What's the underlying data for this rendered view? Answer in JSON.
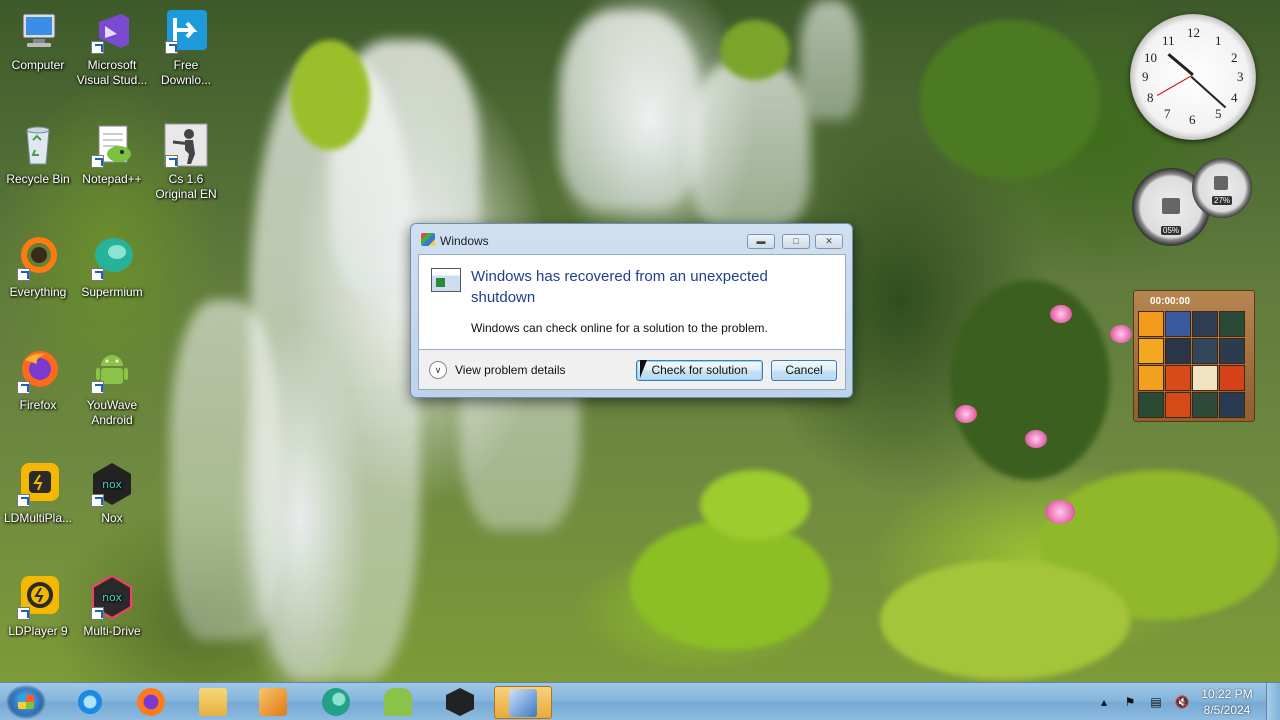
{
  "desktop": {
    "icons": [
      {
        "label": "Computer",
        "icon": "computer-icon"
      },
      {
        "label": "Microsoft Visual Stud...",
        "icon": "visual-studio-icon"
      },
      {
        "label": "Free Downlo...",
        "icon": "free-download-manager-icon"
      },
      {
        "label": "Recycle Bin",
        "icon": "recycle-bin-icon"
      },
      {
        "label": "Notepad++",
        "icon": "notepad-plus-plus-icon"
      },
      {
        "label": "Cs 1.6 Original EN",
        "icon": "counter-strike-icon"
      },
      {
        "label": "Everything",
        "icon": "everything-search-icon"
      },
      {
        "label": "Supermium",
        "icon": "supermium-browser-icon"
      },
      {
        "label": "Firefox",
        "icon": "firefox-icon"
      },
      {
        "label": "YouWave Android",
        "icon": "youwave-android-icon"
      },
      {
        "label": "LDMultiPla...",
        "icon": "ldmultiplayer-icon"
      },
      {
        "label": "Nox",
        "icon": "nox-icon"
      },
      {
        "label": "LDPlayer 9",
        "icon": "ldplayer-icon"
      },
      {
        "label": "Multi-Drive",
        "icon": "nox-multi-drive-icon"
      }
    ]
  },
  "gadgets": {
    "clock_numbers": [
      "12",
      "1",
      "2",
      "3",
      "4",
      "5",
      "6",
      "7",
      "8",
      "9",
      "10",
      "11"
    ],
    "cpu_percent": "05%",
    "memory_percent": "27%",
    "puzzle_time": "00:00:00"
  },
  "dialog": {
    "title": "Windows",
    "heading": "Windows has recovered from an unexpected shutdown",
    "message": "Windows can check online for a solution to the problem.",
    "details_label": "View problem details",
    "check_button": "Check for solution",
    "cancel_button": "Cancel"
  },
  "taskbar": {
    "pinned": [
      {
        "icon": "internet-explorer-icon",
        "color": "#1e88e5"
      },
      {
        "icon": "firefox-icon",
        "color": "#ff7a1a"
      },
      {
        "icon": "file-explorer-icon",
        "color": "#f0c04a"
      },
      {
        "icon": "media-player-icon",
        "color": "#f28c28"
      },
      {
        "icon": "supermium-browser-icon",
        "color": "#21a08a"
      },
      {
        "icon": "youwave-android-icon",
        "color": "#8bc34a"
      },
      {
        "icon": "nox-icon",
        "color": "#222222"
      },
      {
        "icon": "problem-reports-icon",
        "color": "#3a78c8"
      }
    ],
    "time": "10:22 PM",
    "date": "8/5/2024"
  },
  "colors": {
    "dialog_heading": "#1e3f8f",
    "taskbar": "#86b6dc",
    "active_task": "#e9a93b"
  }
}
